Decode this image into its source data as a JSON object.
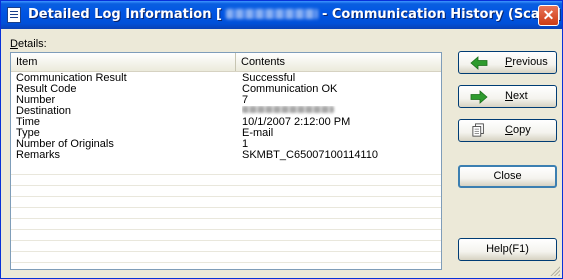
{
  "window": {
    "title_prefix": "Detailed Log Information [",
    "title_suffix": "- Communication History (Scan)]",
    "close_glyph": "✕"
  },
  "details": {
    "label_prefix": "",
    "label_underlined": "D",
    "label_rest": "etails:"
  },
  "table": {
    "columns": [
      "Item",
      "Contents"
    ],
    "rows": [
      {
        "item": "Communication Result",
        "contents": "Successful"
      },
      {
        "item": "Result Code",
        "contents": "Communication OK"
      },
      {
        "item": "Number",
        "contents": "7"
      },
      {
        "item": "Destination",
        "contents": ""
      },
      {
        "item": "Time",
        "contents": "10/1/2007 2:12:00 PM"
      },
      {
        "item": "Type",
        "contents": "E-mail"
      },
      {
        "item": "Number of Originals",
        "contents": "1"
      },
      {
        "item": "Remarks",
        "contents": "SKMBT_C65007100114110"
      }
    ]
  },
  "buttons": {
    "previous": {
      "underlined": "P",
      "rest": "revious",
      "icon": "left-arrow-icon"
    },
    "next": {
      "underlined": "N",
      "rest": "ext",
      "icon": "right-arrow-icon"
    },
    "copy": {
      "underlined": "C",
      "rest": "opy",
      "icon": "copy-icon"
    },
    "close": {
      "label": "Close"
    },
    "help": {
      "label": "Help(F1)"
    }
  },
  "colors": {
    "titlebar": "#0054e3",
    "arrow_green": "#2e9b2e",
    "window_bg": "#ece9d8"
  }
}
